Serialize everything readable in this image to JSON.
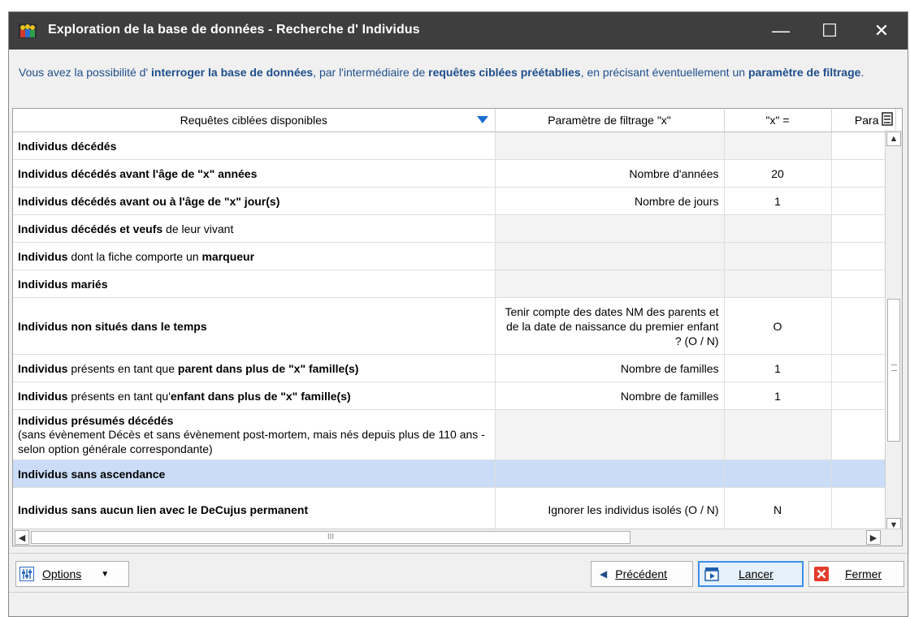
{
  "window": {
    "title": "Exploration de la base de données - Recherche d' Individus",
    "minimize_glyph": "—",
    "maximize_glyph": "☐",
    "close_glyph": "✕"
  },
  "intro": {
    "p1": "Vous avez la possibilité d' ",
    "b1": "interroger la base de données",
    "p2": ", par l'intermédiaire de ",
    "b2": "requêtes ciblées préétablies",
    "p3": ", en précisant éventuellement un ",
    "b3": "paramètre de filtrage",
    "p4": "."
  },
  "grid": {
    "columns": [
      "Requêtes ciblées disponibles",
      "Paramètre de filtrage \"x\"",
      "\"x\" =",
      "Para"
    ],
    "rows": [
      {
        "name_html": "<b>Individus décédés</b>",
        "param": "",
        "value": ""
      },
      {
        "name_html": "<b>Individus décédés avant l'âge de \"x\" années</b>",
        "param": "Nombre d'années",
        "value": "20"
      },
      {
        "name_html": "<b>Individus décédés avant ou à l'âge de \"x\" jour(s)</b>",
        "param": "Nombre de jours",
        "value": "1"
      },
      {
        "name_html": "<b>Individus décédés et veufs</b> de leur vivant",
        "param": "",
        "value": ""
      },
      {
        "name_html": "<b>Individus</b> dont la fiche comporte un <b>marqueur</b>",
        "param": "",
        "value": ""
      },
      {
        "name_html": "<b>Individus mariés</b>",
        "param": "",
        "value": ""
      },
      {
        "name_html": "<b>Individus non situés dans le temps</b>",
        "param": "Tenir compte des dates NM des parents et de la date de naissance du premier enfant ? (O / N)",
        "value": "O"
      },
      {
        "name_html": "<b>Individus</b> présents en tant que <b>parent dans plus de \"x\" famille(s)</b>",
        "param": "Nombre de familles",
        "value": "1"
      },
      {
        "name_html": "<b>Individus</b> présents en tant qu'<b>enfant dans plus de \"x\" famille(s)</b>",
        "param": "Nombre de familles",
        "value": "1"
      },
      {
        "name_html": "<b>Individus présumés décédés</b><br><span class=\"desc-small\">(sans évènement Décès et sans évènement post-mortem, mais nés depuis plus de 110 ans - selon option générale correspondante)</span>",
        "param": "",
        "value": ""
      },
      {
        "name_html": "<b>Individus sans ascendance</b>",
        "param": "",
        "value": ""
      },
      {
        "name_html": "<b>Individus sans aucun lien avec le DeCujus permanent</b>",
        "param": "Ignorer les individus isolés (O / N)",
        "value": "N"
      }
    ],
    "selected_row": 10,
    "hscroll_grip": "III",
    "vscroll_grip": "≡"
  },
  "footer": {
    "options_label": "Options",
    "prev_label": "Précédent",
    "run_label": "Lancer",
    "close_label": "Fermer"
  },
  "colors": {
    "titlebar": "#3e3e3e",
    "intro_text": "#1e4e8c",
    "selected_row": "#cadcf7",
    "accent": "#3a8ee6"
  }
}
